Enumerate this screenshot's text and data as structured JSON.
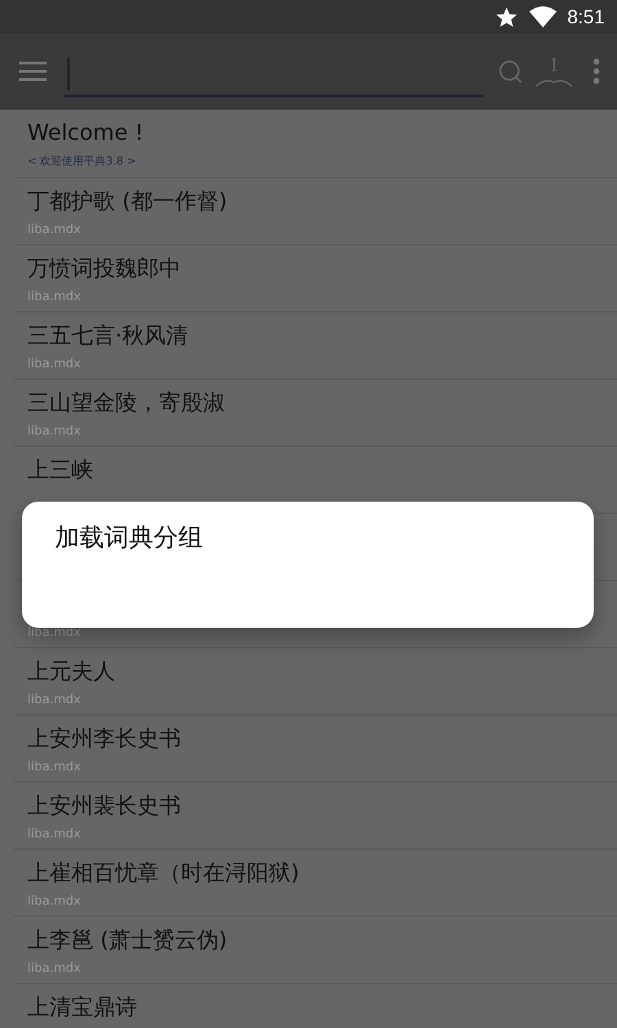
{
  "status_bar": {
    "time": "8:51"
  },
  "toolbar": {
    "group_badge": "1"
  },
  "welcome": {
    "title": "Welcome !",
    "subtitle": "< 欢迎使用平典3.8 >"
  },
  "entries": [
    {
      "title": "丁都护歌 (都一作督)",
      "source": "liba.mdx"
    },
    {
      "title": "万愤词投魏郎中",
      "source": "liba.mdx"
    },
    {
      "title": "三五七言·秋风清",
      "source": "liba.mdx"
    },
    {
      "title": "三山望金陵，寄殷淑",
      "source": "liba.mdx"
    },
    {
      "title": "上三峡"
    }
  ],
  "entries_below_dialog": [
    {
      "source": "liba.mdx"
    },
    {
      "title": "上元夫人",
      "source": "liba.mdx"
    },
    {
      "title": "上安州李长史书",
      "source": "liba.mdx"
    },
    {
      "title": "上安州裴长史书",
      "source": "liba.mdx"
    },
    {
      "title": "上崔相百忧章（时在浔阳狱)",
      "source": "liba.mdx"
    },
    {
      "title": "上李邕 (萧士赟云伪)",
      "source": "liba.mdx"
    },
    {
      "title": "上清宝鼎诗"
    }
  ],
  "dialog": {
    "title": "加载词典分组"
  }
}
